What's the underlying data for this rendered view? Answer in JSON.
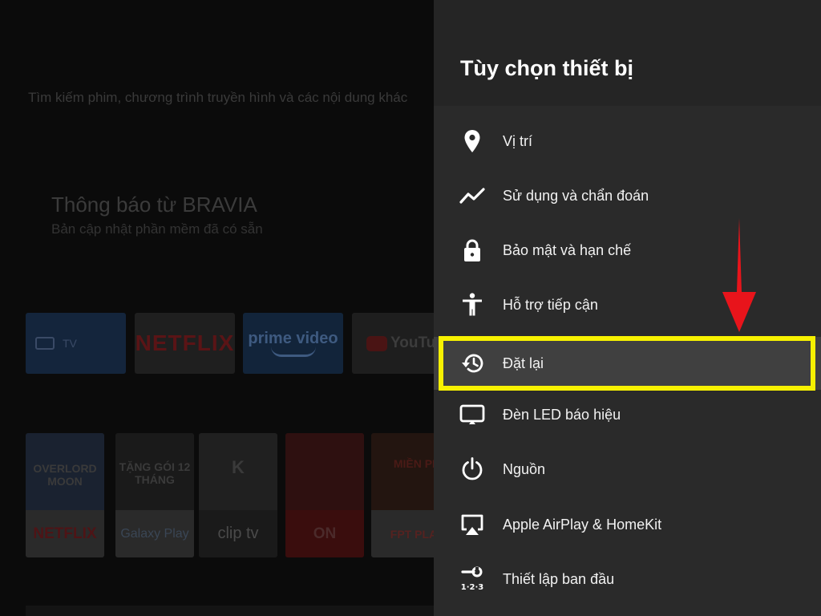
{
  "home": {
    "search_hint": "Tìm kiếm phim, chương trình truyền hình và các nội dung khác",
    "notification_title": "Thông báo từ BRAVIA",
    "notification_subtitle": "Bản cập nhật phần mềm đã có sẵn",
    "apps": [
      {
        "label": "TV"
      },
      {
        "label": "NETFLIX"
      },
      {
        "label": "prime video"
      },
      {
        "label": "YouTube"
      }
    ],
    "media": [
      {
        "poster": "OVERLORD MOON",
        "brand": "NETFLIX"
      },
      {
        "poster": "TẶNG GÓI 12 THÁNG",
        "brand": "Galaxy Play"
      },
      {
        "poster": "K",
        "brand": "clip tv"
      },
      {
        "poster": "",
        "brand": "ON"
      },
      {
        "poster": "MIỀN PH",
        "brand": "FPT PLAY"
      }
    ]
  },
  "panel": {
    "title": "Tùy chọn thiết bị",
    "items": [
      {
        "label": "Vị trí",
        "icon": "location-pin-icon"
      },
      {
        "label": "Sử dụng và chẩn đoán",
        "icon": "trend-line-icon"
      },
      {
        "label": "Bảo mật và hạn chế",
        "icon": "lock-icon"
      },
      {
        "label": "Hỗ trợ tiếp cận",
        "icon": "accessibility-icon"
      },
      {
        "label": "Đặt lại",
        "icon": "history-icon",
        "selected": true
      },
      {
        "label": "Đèn LED báo hiệu",
        "icon": "monitor-icon"
      },
      {
        "label": "Nguồn",
        "icon": "power-icon"
      },
      {
        "label": "Apple AirPlay & HomeKit",
        "icon": "airplay-icon"
      },
      {
        "label": "Thiết lập ban đầu",
        "icon": "setup-tool-icon"
      }
    ]
  },
  "annotation": {
    "highlight_color": "#f7f100",
    "arrow_color": "#e8141b"
  },
  "colors": {
    "panel_bg": "#2a2a2a",
    "header_bg": "#252525",
    "selected_bg": "#404040"
  }
}
